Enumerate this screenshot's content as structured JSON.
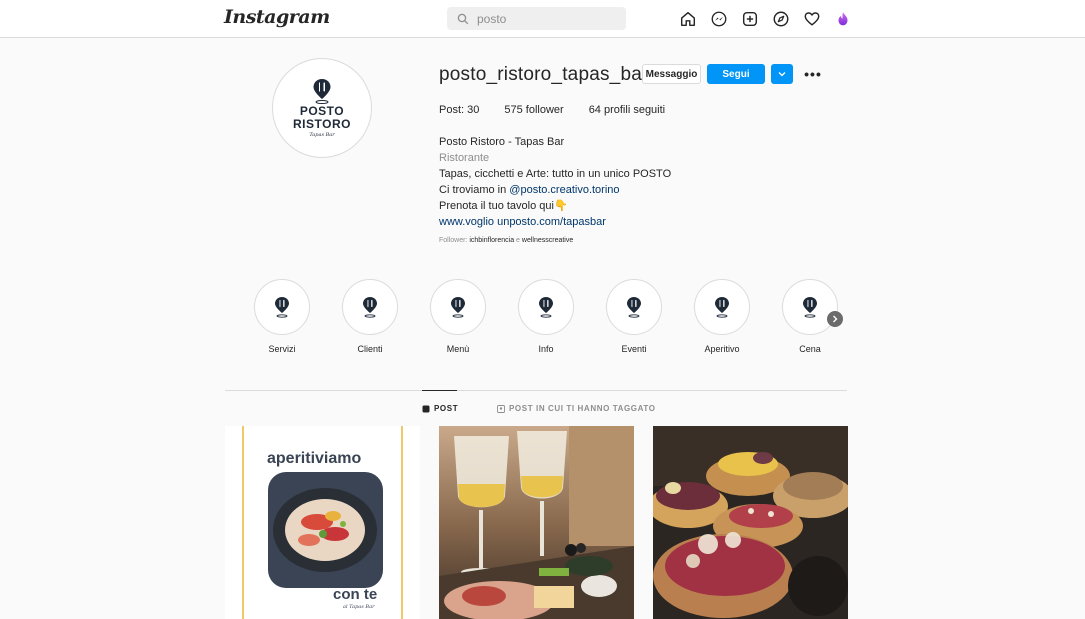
{
  "nav": {
    "logo": "Instagram",
    "search_value": "posto",
    "icons": [
      "home-icon",
      "messenger-icon",
      "new-post-icon",
      "explore-icon",
      "activity-heart-icon",
      "profile-avatar"
    ]
  },
  "profile": {
    "username": "posto_ristoro_tapas_bar",
    "buttons": {
      "message": "Messaggio",
      "follow": "Segui"
    },
    "avatar_lines": [
      "POSTO",
      "RISTORO",
      "Tapas Bar"
    ],
    "stats": {
      "posts": "Post: 30",
      "followers": "575 follower",
      "following": "64 profili seguiti"
    },
    "bio": {
      "name": "Posto Ristoro - Tapas Bar",
      "category": "Ristorante",
      "line1": "Tapas, cicchetti e Arte: tutto in un unico POSTO",
      "line2_prefix": "Ci troviamo in ",
      "line2_mention": "@posto.creativo.torino",
      "line3": "Prenota il tuo tavolo qui",
      "line3_emoji": "👇",
      "link": "www.voglio unposto.com/tapasbar"
    },
    "followed_by": {
      "prefix": "Follower: ",
      "user1": "ichbinflorencia",
      "joiner": " e ",
      "user2": "wellnesscreative"
    }
  },
  "highlights": [
    "Servizi",
    "Clienti",
    "Menù",
    "Info",
    "Eventi",
    "Aperitivo",
    "Cena"
  ],
  "tabs": {
    "posts": "POST",
    "tagged": "POST IN CUI TI HANNO TAGGATO"
  },
  "posts": {
    "p1_title": "aperitiviamo",
    "p1_sub": "con te",
    "p1_tag": "al Tapas Bar"
  },
  "colors": {
    "accent": "#0095f6",
    "brand_dark": "#1f2a38"
  }
}
